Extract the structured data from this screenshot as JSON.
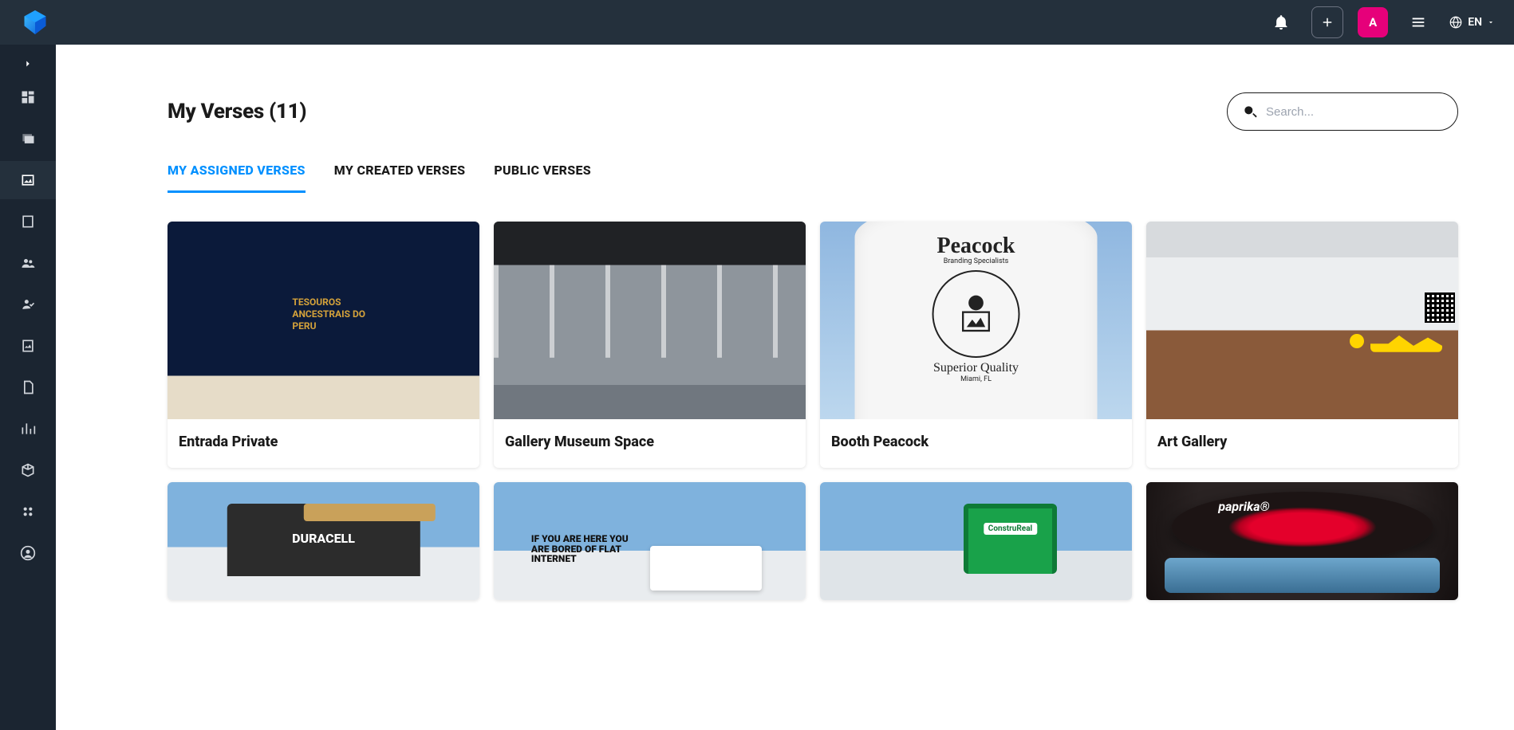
{
  "header": {
    "avatar_initial": "A",
    "language": "EN"
  },
  "page": {
    "title": "My Verses (11)",
    "search_placeholder": "Search..."
  },
  "tabs": [
    {
      "label": "MY ASSIGNED VERSES",
      "active": true
    },
    {
      "label": "MY CREATED VERSES",
      "active": false
    },
    {
      "label": "PUBLIC VERSES",
      "active": false
    }
  ],
  "cards": [
    {
      "title": "Entrada Private"
    },
    {
      "title": "Gallery Museum Space"
    },
    {
      "title": "Booth Peacock"
    },
    {
      "title": "Art Gallery"
    }
  ],
  "thumb1_overlay": "TESOUROS\nANCESTRAIS DO\nPERU",
  "thumb3": {
    "brand": "Peacock",
    "tagline": "Branding Specialists",
    "quality": "Superior Quality",
    "city": "Miami, FL"
  },
  "thumb6_sign": "IF YOU ARE HERE YOU ARE BORED OF FLAT INTERNET"
}
